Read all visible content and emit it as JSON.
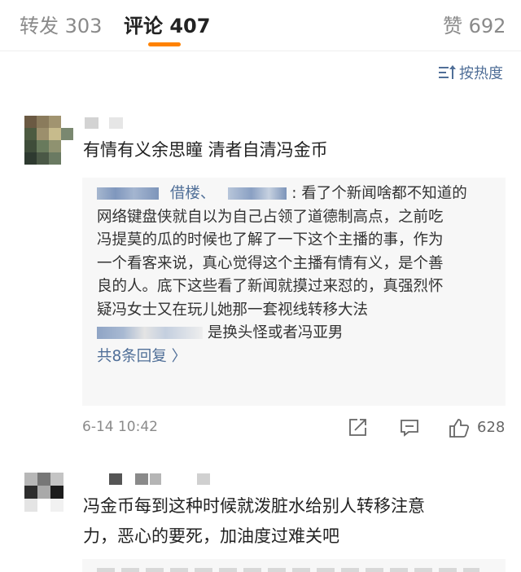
{
  "tabs": {
    "repost": "转发 303",
    "comments": "评论 407",
    "likes": "赞 692"
  },
  "colors": {
    "accent": "#ff8200",
    "link": "#506f98",
    "reply_bg": "#f7f7f7"
  },
  "sort": {
    "label": "按热度",
    "icon": "sort-icon"
  },
  "comments": [
    {
      "text": "有情有义余思瞳 清者自清冯金币",
      "reply": {
        "line1_a": "借楼、",
        "line1_b": ": 看了个新闻啥都不知道的",
        "line2": "网络键盘侠就自以为自己占领了道德制高点，之前吃",
        "line3": "冯提莫的瓜的时候也了解了一下这个主播的事，作为",
        "line4": "一个看客来说，真心觉得这个主播有情有义，是个善",
        "line5": "良的人。底下这些看了新闻就摸过来怼的，真强烈怀",
        "line6": "疑冯女士又在玩儿她那一套视线转移大法",
        "line7": "是换头怪或者冯亚男",
        "more": "共8条回复 〉"
      },
      "time": "6-14 10:42",
      "likes": "628",
      "icons": [
        "share-icon",
        "comment-icon",
        "like-icon"
      ]
    },
    {
      "text_line1": "冯金币每到这种时候就泼脏水给别人转移注意",
      "text_line2": "力，恶心的要死，加油度过难关吧"
    }
  ]
}
